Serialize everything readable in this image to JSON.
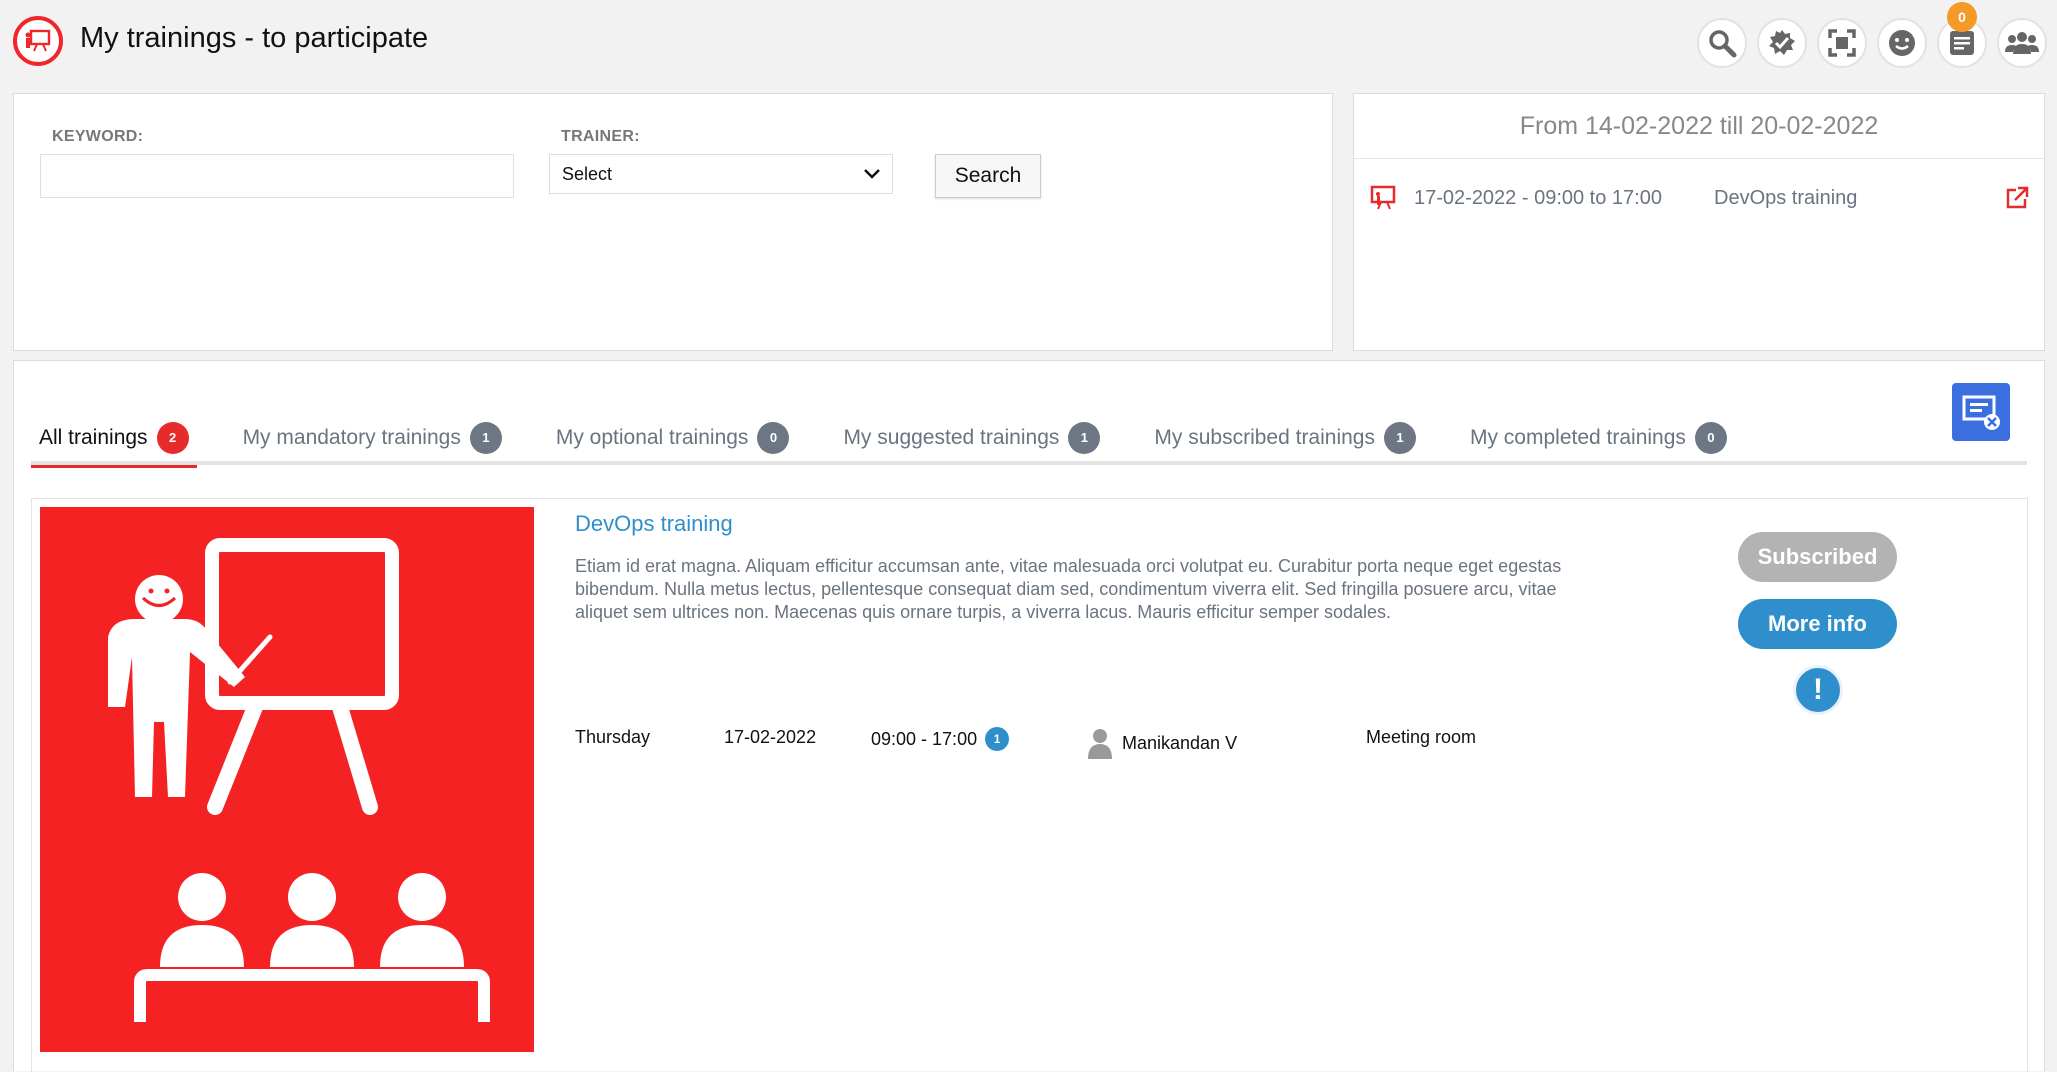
{
  "header": {
    "title": "My trainings - to participate",
    "logo_icon": "training-presentation-icon",
    "icons": [
      "search-icon",
      "approve-icon",
      "fullscreen-icon",
      "smiley-icon",
      "notes-icon",
      "group-icon"
    ],
    "notification_count": "0",
    "accent": "#f0272a"
  },
  "search": {
    "keyword_label": "KEYWORD:",
    "keyword_value": "",
    "trainer_label": "TRAINER:",
    "trainer_selected": "Select",
    "search_label": "Search"
  },
  "week": {
    "title": "From 14-02-2022 till 20-02-2022",
    "items": [
      {
        "datetime": "17-02-2022 - 09:00 to 17:00",
        "name": "DevOps training"
      }
    ]
  },
  "tabs": [
    {
      "label": "All trainings",
      "count": "2",
      "active": true
    },
    {
      "label": "My mandatory trainings",
      "count": "1"
    },
    {
      "label": "My optional trainings",
      "count": "0"
    },
    {
      "label": "My suggested trainings",
      "count": "1"
    },
    {
      "label": "My subscribed trainings",
      "count": "1"
    },
    {
      "label": "My completed trainings",
      "count": "0"
    }
  ],
  "trainings": [
    {
      "title": "DevOps training",
      "description": "Etiam id erat magna. Aliquam efficitur accumsan ante, vitae malesuada orci volutpat eu. Curabitur porta neque eget egestas bibendum. Nulla metus lectus, pellentesque consequat diam sed, condimentum viverra elit. Sed fringilla posuere arcu, vitae aliquet sem ultrices non. Maecenas quis ornare turpis, a viverra lacus. Mauris efficitur semper sodales.",
      "day": "Thursday",
      "date": "17-02-2022",
      "time": "09:00 - 17:00",
      "sessions": "1",
      "trainer": "Manikandan V",
      "location": "Meeting room",
      "status_label": "Subscribed",
      "more_label": "More info",
      "alert_glyph": "!",
      "image_color": "#f52224"
    }
  ]
}
